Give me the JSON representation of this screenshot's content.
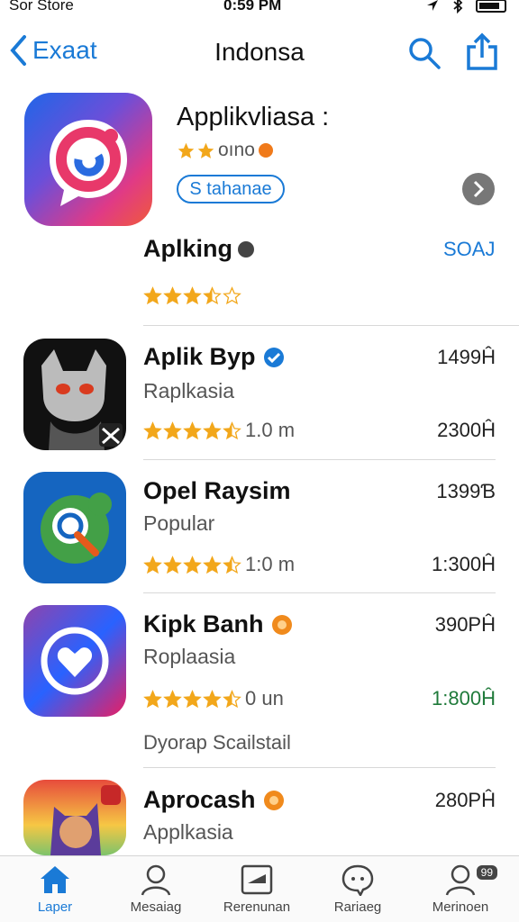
{
  "status": {
    "carrier": "Sor Store",
    "time": "0:59 PM"
  },
  "nav": {
    "back_label": "Exaat",
    "title": "Indonsa"
  },
  "featured": {
    "title": "Apрlіkvliasa :",
    "rating_text": "oıno",
    "pill_label": "S tahanae",
    "name": "Aplking",
    "get_label": "SOAJ",
    "stars": 3.5
  },
  "apps": [
    {
      "name": "Aplik Byp",
      "subtitle": "Raplkasia",
      "rating": 4.5,
      "rating_text": "1.0 m",
      "price_top": "1499Ĥ",
      "price": "2300Ĥ",
      "badge": "verified",
      "extra": ""
    },
    {
      "name": "Opel Raysim",
      "subtitle": "Popular",
      "rating": 4.5,
      "rating_text": "1:0 m",
      "price_top": "1399Ɓ",
      "price": "1:300Ĥ",
      "badge": "",
      "extra": ""
    },
    {
      "name": "Kipk Banh",
      "subtitle": "Roplaasia",
      "rating": 4.5,
      "rating_text": "0 un",
      "price_top": "390PĤ",
      "price": "1:800Ĥ",
      "badge": "orange",
      "extra": "Dyorap Scailstail"
    },
    {
      "name": "Aprocash",
      "subtitle": "Applkasia",
      "rating": 0,
      "rating_text": "",
      "price_top": "280PĤ",
      "price": "",
      "badge": "orange",
      "extra": ""
    }
  ],
  "tabs": [
    {
      "label": "Laper",
      "icon": "home-icon",
      "active": true
    },
    {
      "label": "Mesaiag",
      "icon": "profile-icon",
      "active": false
    },
    {
      "label": "Rerenunan",
      "icon": "card-icon",
      "active": false
    },
    {
      "label": "Rariaeg",
      "icon": "chat-icon",
      "active": false
    },
    {
      "label": "Merinoen",
      "icon": "account-icon",
      "active": false,
      "badge": "99"
    }
  ],
  "colors": {
    "accent": "#1a7ad6",
    "star": "#f2a71b",
    "price_green": "#1f7a3a"
  }
}
